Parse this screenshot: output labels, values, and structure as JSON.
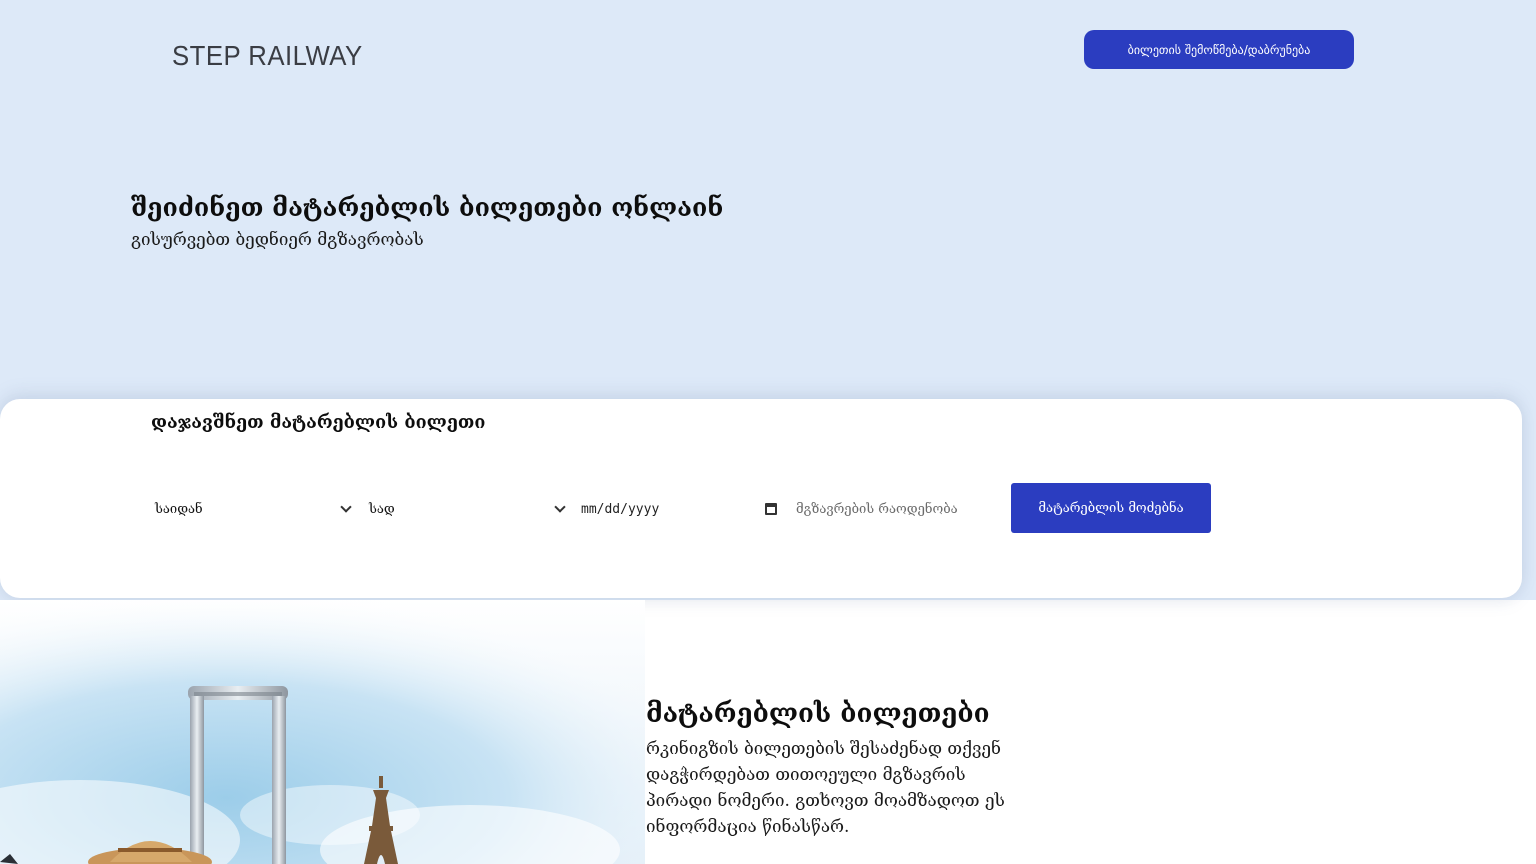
{
  "header": {
    "logo_text": "STEP RAILWAY",
    "check_button_label": "ბილეთის შემოწმება/დაბრუნება"
  },
  "hero": {
    "title": "შეიძინეთ მატარებლის ბილეთები ონლაინ",
    "subtitle": "გისურვებთ ბედნიერ მგზავრობას"
  },
  "booking": {
    "title": "დაჯავშნეთ მატარებლის ბილეთი",
    "from_select": "საიდან",
    "to_select": "სად",
    "date_placeholder": "mm/dd/yyyy",
    "passengers_placeholder": "მგზავრების რაოდენობა",
    "search_button_label": "მატარებლის მოძებნა"
  },
  "info": {
    "title": "მატარებლის ბილეთები",
    "text": "რკინიგზის ბილეთების შესაძენად თქვენ დაგჭირდებათ თითოეული მგზავრის პირადი ნომერი. გთხოვთ მოამზადოთ ეს ინფორმაცია წინასწარ."
  },
  "colors": {
    "hero_background": "#dde9f8",
    "accent": "#2b3dc0"
  },
  "icons": {
    "dropdown": "chevron-down-icon",
    "date": "calendar-icon"
  }
}
